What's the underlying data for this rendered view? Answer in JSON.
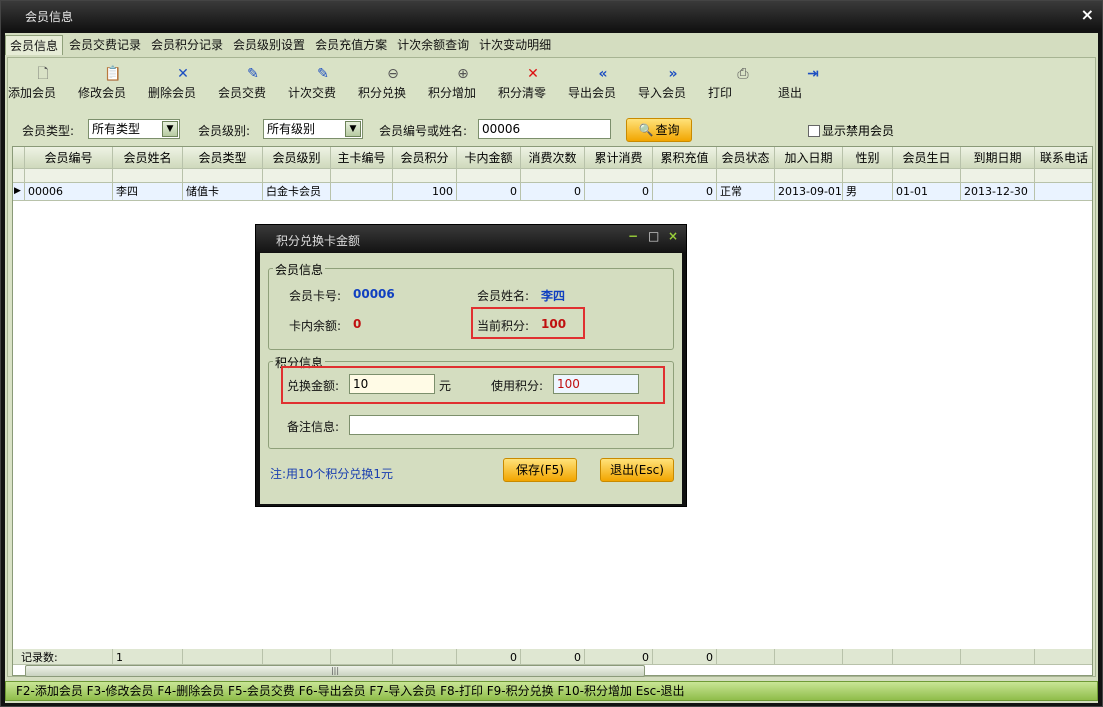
{
  "window": {
    "title": "会员信息",
    "close_glyph": "×"
  },
  "tabs": [
    {
      "label": "会员信息",
      "active": true
    },
    {
      "label": "会员交费记录"
    },
    {
      "label": "会员积分记录"
    },
    {
      "label": "会员级别设置"
    },
    {
      "label": "会员充值方案"
    },
    {
      "label": "计次余额查询"
    },
    {
      "label": "计次变动明细"
    }
  ],
  "toolbar": [
    {
      "label": "添加会员",
      "icon": "document-icon"
    },
    {
      "label": "修改会员",
      "icon": "clipboard-edit-icon"
    },
    {
      "label": "删除会员",
      "icon": "x-icon"
    },
    {
      "label": "会员交费",
      "icon": "pen-icon"
    },
    {
      "label": "计次交费",
      "icon": "pen-icon"
    },
    {
      "label": "积分兑换",
      "icon": "zoom-out-icon"
    },
    {
      "label": "积分增加",
      "icon": "zoom-in-icon"
    },
    {
      "label": "积分清零",
      "icon": "x-icon"
    },
    {
      "label": "导出会员",
      "icon": "double-left-icon"
    },
    {
      "label": "导入会员",
      "icon": "double-right-icon"
    },
    {
      "label": "打印",
      "icon": "printer-icon"
    },
    {
      "label": "退出",
      "icon": "exit-door-icon"
    }
  ],
  "filter": {
    "type_label": "会员类型:",
    "type_value": "所有类型",
    "level_label": "会员级别:",
    "level_value": "所有级别",
    "search_label": "会员编号或姓名:",
    "search_value": "00006",
    "query_button": "查询",
    "show_disabled": "显示禁用会员"
  },
  "grid": {
    "columns": [
      "会员编号",
      "会员姓名",
      "会员类型",
      "会员级别",
      "主卡编号",
      "会员积分",
      "卡内金额",
      "消费次数",
      "累计消费",
      "累积充值",
      "会员状态",
      "加入日期",
      "性别",
      "会员生日",
      "到期日期",
      "联系电话"
    ],
    "rows": [
      [
        "00006",
        "李四",
        "储值卡",
        "白金卡会员",
        "",
        "100",
        "0",
        "0",
        "0",
        "0",
        "正常",
        "2013-09-01",
        "男",
        "01-01",
        "2013-12-30",
        ""
      ]
    ],
    "summary_label": "记录数:",
    "summary_values": [
      "1",
      "",
      "",
      "",
      "",
      "0",
      "0",
      "0",
      "0",
      "",
      "",
      "",
      "",
      "",
      ""
    ]
  },
  "statusbar": {
    "text": "F2-添加会员 F3-修改会员 F4-删除会员 F5-会员交费 F6-导出会员 F7-导入会员 F8-打印 F9-积分兑换 F10-积分增加 Esc-退出"
  },
  "dialog": {
    "title": "积分兑换卡金额",
    "controls": {
      "minimize": "−",
      "maximize": "□",
      "close": "×"
    },
    "member_group": "会员信息",
    "card_no_label": "会员卡号:",
    "card_no": "00006",
    "name_label": "会员姓名:",
    "name": "李四",
    "balance_label": "卡内余额:",
    "balance": "0",
    "points_label": "当前积分:",
    "points": "100",
    "points_group": "积分信息",
    "amount_label": "兑换金额:",
    "amount_value": "10",
    "amount_unit": "元",
    "use_points_label": "使用积分:",
    "use_points_value": "100",
    "remark_label": "备注信息:",
    "remark_value": "",
    "note": "注:用10个积分兑换1元",
    "save_button": "保存(F5)",
    "exit_button": "退出(Esc)"
  }
}
